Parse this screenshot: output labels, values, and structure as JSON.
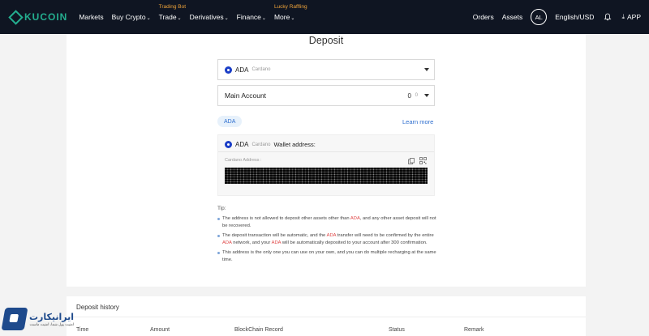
{
  "nav": {
    "logo": "KUCOIN",
    "items": [
      {
        "label": "Markets",
        "caret": false,
        "tag": ""
      },
      {
        "label": "Buy Crypto",
        "caret": true,
        "tag": ""
      },
      {
        "label": "Trade",
        "caret": true,
        "tag": "Trading Bot"
      },
      {
        "label": "Derivatives",
        "caret": true,
        "tag": ""
      },
      {
        "label": "Finance",
        "caret": true,
        "tag": ""
      },
      {
        "label": "More",
        "caret": true,
        "tag": "Lucky Raffling"
      }
    ],
    "orders": "Orders",
    "assets": "Assets",
    "avatar": "AL",
    "locale": "English/USD",
    "app": "APP"
  },
  "deposit": {
    "title": "Deposit",
    "coin_symbol": "ADA",
    "coin_name": "Cardano",
    "account_label": "Main Account",
    "account_balance": "0",
    "account_unit": "0",
    "chip": "ADA",
    "learn_more": "Learn more",
    "wallet_label": "Wallet address:",
    "address_label": "Cardano Address :"
  },
  "tips": {
    "title": "Tip:",
    "items": [
      [
        "The address is not allowed to deposit other assets other than ",
        "ADA",
        ", and any other asset deposit will not be recovered."
      ],
      [
        "The deposit transaction will be automatic, and the ",
        "ADA",
        " transfer will need to be confirmed by the entire ",
        "ADA",
        " network, and your ",
        "ADA",
        " will be automatically deposited to your account after 300 confirmation."
      ],
      [
        "This address is the only one you can use on your own, and you can do multiple recharging at the same time."
      ]
    ]
  },
  "history": {
    "title": "Deposit history",
    "columns": [
      "Time",
      "Amount",
      "BlockChain Record",
      "Status",
      "Remark"
    ]
  },
  "watermark": {
    "main": "ایرانیکارت",
    "sub": "امنیت پول شما، امنیت ماست"
  },
  "colors": {
    "nav_bg": "#0f1522",
    "brand": "#24ae8f",
    "tag": "#f0a43a",
    "link": "#2f6fcf",
    "highlight": "#e04848"
  }
}
